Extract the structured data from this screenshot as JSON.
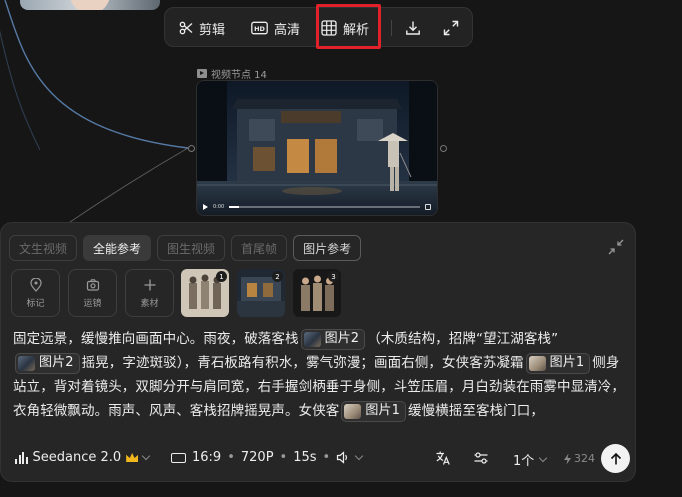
{
  "toolbar": {
    "cut_label": "剪辑",
    "hd_label": "高清",
    "parse_label": "解析",
    "highlight_color": "#e2222a",
    "icons": [
      "scissors-icon",
      "hd-icon",
      "grid-icon",
      "download-icon",
      "fullscreen-icon"
    ]
  },
  "video_node": {
    "label": "视频节点 14",
    "progress": 0.05
  },
  "panel": {
    "tabs": [
      {
        "label": "文生视频",
        "active": false
      },
      {
        "label": "全能参考",
        "active": true
      },
      {
        "label": "图生视频",
        "active": false
      },
      {
        "label": "首尾帧",
        "active": false
      },
      {
        "label": "图片参考",
        "active": false
      }
    ],
    "tools": [
      {
        "label": "标记",
        "icon": "location-pin-icon"
      },
      {
        "label": "运镜",
        "icon": "camera-icon"
      },
      {
        "label": "素材",
        "icon": "plus-icon"
      }
    ],
    "thumbnails": [
      {
        "num": "1",
        "subject": "warrior"
      },
      {
        "num": "2",
        "subject": "street"
      },
      {
        "num": "3",
        "subject": "group"
      }
    ],
    "prompt": {
      "p1": "固定远景，缓慢推向画面中心。雨夜，破落客栈",
      "chip_a": "图片2",
      "p2": "（木质结构，招牌“望江湖客栈”",
      "chip_b": "图片2",
      "p3": "摇晃，字迹斑驳），青石板路有积水，雾气弥漫；画面右侧，女侠客苏凝霜",
      "chip_c": "图片1",
      "p4": "侧身站立，背对着镜头，双脚分开与肩同宽，右手握剑柄垂于身侧，斗笠压眉，月白劲装在雨雾中显清冷，衣角轻微飘动。雨声、风声、客栈招牌摇晃声。女侠客",
      "chip_d": "图片1",
      "p5": "缓慢横摇至客栈门口，"
    }
  },
  "bottom_bar": {
    "model": "Seedance 2.0",
    "ratio": "16:9",
    "resolution": "720P",
    "duration": "15s",
    "count": "1个",
    "credits": "324",
    "sep": "•"
  }
}
